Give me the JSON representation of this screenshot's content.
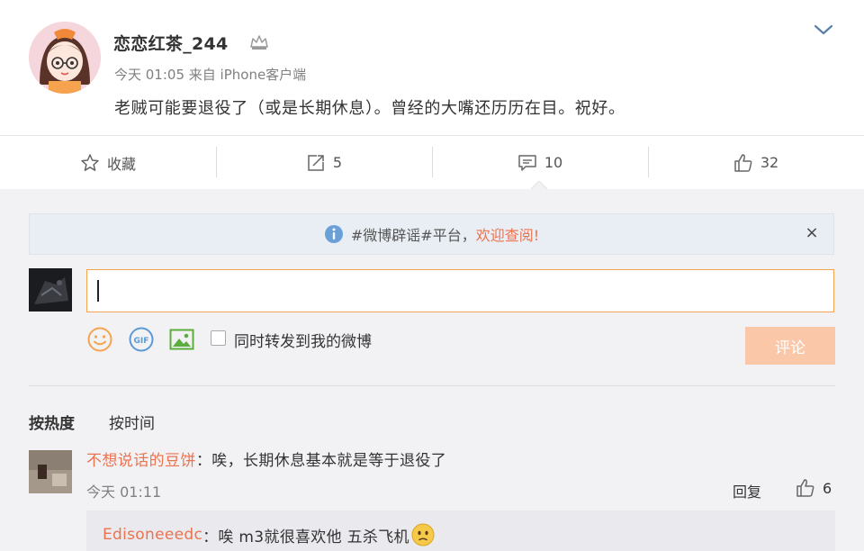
{
  "post": {
    "username": "恋恋红茶_244",
    "time": "今天 01:05",
    "source": "来自 iPhone客户端",
    "text": "老贼可能要退役了（或是长期休息）。曾经的大嘴还历历在目。祝好。"
  },
  "actions": {
    "favorite_label": "收藏",
    "repost_count": "5",
    "comment_count": "10",
    "like_count": "32"
  },
  "notice": {
    "text": "#微博辟谣#平台，",
    "link": "欢迎查阅!",
    "close": "×"
  },
  "composer": {
    "input_value": "",
    "repost_label": "同时转发到我的微博",
    "submit_label": "评论"
  },
  "sort": {
    "hot": "按热度",
    "time": "按时间"
  },
  "comments": [
    {
      "user": "不想说话的豆饼",
      "text": "：唉，长期休息基本就是等于退役了",
      "time": "今天 01:11",
      "reply_label": "回复",
      "likes": "6",
      "sub_reply": {
        "user": "Edisoneeedc",
        "text": "：唉 m3就很喜欢他 五杀飞机"
      }
    }
  ],
  "colors": {
    "accent_orange": "#eb7350",
    "submit_disabled": "#fbc7a9",
    "input_border": "#f5a34f",
    "comment_bg": "#f2f2f5"
  },
  "icons": {
    "crown": "crown-icon",
    "expand": "chevron-down-icon",
    "favorite": "star-icon",
    "repost": "share-icon",
    "comment": "comment-icon",
    "like": "thumb-up-icon",
    "info": "info-icon",
    "emoji": "smiley-icon",
    "gif": "gif-icon",
    "image": "image-icon"
  }
}
